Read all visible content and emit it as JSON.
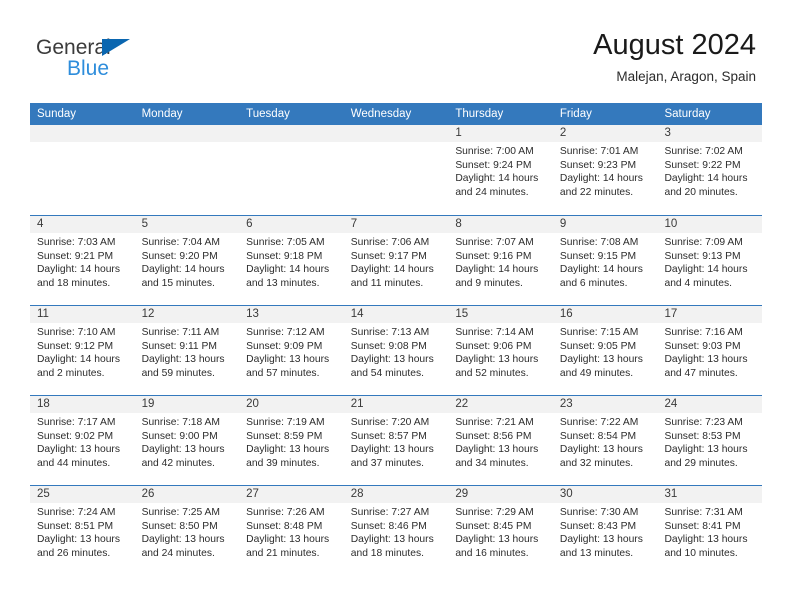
{
  "brand": {
    "name_part1": "General",
    "name_part2": "Blue",
    "triangle_icon": "triangle-icon",
    "accent_color": "#2e8ddb",
    "dark_color": "#3b3b3b",
    "triangle_color": "#0a66b0"
  },
  "header": {
    "title": "August 2024",
    "subtitle": "Malejan, Aragon, Spain"
  },
  "calendar": {
    "header_bg": "#3479bd",
    "daynum_bg": "#f2f2f2",
    "weekday_headers": [
      "Sunday",
      "Monday",
      "Tuesday",
      "Wednesday",
      "Thursday",
      "Friday",
      "Saturday"
    ],
    "labels": {
      "sunrise": "Sunrise:",
      "sunset": "Sunset:",
      "daylight": "Daylight:"
    },
    "weeks": [
      [
        {
          "day": ""
        },
        {
          "day": ""
        },
        {
          "day": ""
        },
        {
          "day": ""
        },
        {
          "day": "1",
          "sunrise": "Sunrise: 7:00 AM",
          "sunset": "Sunset: 9:24 PM",
          "daylight": "Daylight: 14 hours and 24 minutes."
        },
        {
          "day": "2",
          "sunrise": "Sunrise: 7:01 AM",
          "sunset": "Sunset: 9:23 PM",
          "daylight": "Daylight: 14 hours and 22 minutes."
        },
        {
          "day": "3",
          "sunrise": "Sunrise: 7:02 AM",
          "sunset": "Sunset: 9:22 PM",
          "daylight": "Daylight: 14 hours and 20 minutes."
        }
      ],
      [
        {
          "day": "4",
          "sunrise": "Sunrise: 7:03 AM",
          "sunset": "Sunset: 9:21 PM",
          "daylight": "Daylight: 14 hours and 18 minutes."
        },
        {
          "day": "5",
          "sunrise": "Sunrise: 7:04 AM",
          "sunset": "Sunset: 9:20 PM",
          "daylight": "Daylight: 14 hours and 15 minutes."
        },
        {
          "day": "6",
          "sunrise": "Sunrise: 7:05 AM",
          "sunset": "Sunset: 9:18 PM",
          "daylight": "Daylight: 14 hours and 13 minutes."
        },
        {
          "day": "7",
          "sunrise": "Sunrise: 7:06 AM",
          "sunset": "Sunset: 9:17 PM",
          "daylight": "Daylight: 14 hours and 11 minutes."
        },
        {
          "day": "8",
          "sunrise": "Sunrise: 7:07 AM",
          "sunset": "Sunset: 9:16 PM",
          "daylight": "Daylight: 14 hours and 9 minutes."
        },
        {
          "day": "9",
          "sunrise": "Sunrise: 7:08 AM",
          "sunset": "Sunset: 9:15 PM",
          "daylight": "Daylight: 14 hours and 6 minutes."
        },
        {
          "day": "10",
          "sunrise": "Sunrise: 7:09 AM",
          "sunset": "Sunset: 9:13 PM",
          "daylight": "Daylight: 14 hours and 4 minutes."
        }
      ],
      [
        {
          "day": "11",
          "sunrise": "Sunrise: 7:10 AM",
          "sunset": "Sunset: 9:12 PM",
          "daylight": "Daylight: 14 hours and 2 minutes."
        },
        {
          "day": "12",
          "sunrise": "Sunrise: 7:11 AM",
          "sunset": "Sunset: 9:11 PM",
          "daylight": "Daylight: 13 hours and 59 minutes."
        },
        {
          "day": "13",
          "sunrise": "Sunrise: 7:12 AM",
          "sunset": "Sunset: 9:09 PM",
          "daylight": "Daylight: 13 hours and 57 minutes."
        },
        {
          "day": "14",
          "sunrise": "Sunrise: 7:13 AM",
          "sunset": "Sunset: 9:08 PM",
          "daylight": "Daylight: 13 hours and 54 minutes."
        },
        {
          "day": "15",
          "sunrise": "Sunrise: 7:14 AM",
          "sunset": "Sunset: 9:06 PM",
          "daylight": "Daylight: 13 hours and 52 minutes."
        },
        {
          "day": "16",
          "sunrise": "Sunrise: 7:15 AM",
          "sunset": "Sunset: 9:05 PM",
          "daylight": "Daylight: 13 hours and 49 minutes."
        },
        {
          "day": "17",
          "sunrise": "Sunrise: 7:16 AM",
          "sunset": "Sunset: 9:03 PM",
          "daylight": "Daylight: 13 hours and 47 minutes."
        }
      ],
      [
        {
          "day": "18",
          "sunrise": "Sunrise: 7:17 AM",
          "sunset": "Sunset: 9:02 PM",
          "daylight": "Daylight: 13 hours and 44 minutes."
        },
        {
          "day": "19",
          "sunrise": "Sunrise: 7:18 AM",
          "sunset": "Sunset: 9:00 PM",
          "daylight": "Daylight: 13 hours and 42 minutes."
        },
        {
          "day": "20",
          "sunrise": "Sunrise: 7:19 AM",
          "sunset": "Sunset: 8:59 PM",
          "daylight": "Daylight: 13 hours and 39 minutes."
        },
        {
          "day": "21",
          "sunrise": "Sunrise: 7:20 AM",
          "sunset": "Sunset: 8:57 PM",
          "daylight": "Daylight: 13 hours and 37 minutes."
        },
        {
          "day": "22",
          "sunrise": "Sunrise: 7:21 AM",
          "sunset": "Sunset: 8:56 PM",
          "daylight": "Daylight: 13 hours and 34 minutes."
        },
        {
          "day": "23",
          "sunrise": "Sunrise: 7:22 AM",
          "sunset": "Sunset: 8:54 PM",
          "daylight": "Daylight: 13 hours and 32 minutes."
        },
        {
          "day": "24",
          "sunrise": "Sunrise: 7:23 AM",
          "sunset": "Sunset: 8:53 PM",
          "daylight": "Daylight: 13 hours and 29 minutes."
        }
      ],
      [
        {
          "day": "25",
          "sunrise": "Sunrise: 7:24 AM",
          "sunset": "Sunset: 8:51 PM",
          "daylight": "Daylight: 13 hours and 26 minutes."
        },
        {
          "day": "26",
          "sunrise": "Sunrise: 7:25 AM",
          "sunset": "Sunset: 8:50 PM",
          "daylight": "Daylight: 13 hours and 24 minutes."
        },
        {
          "day": "27",
          "sunrise": "Sunrise: 7:26 AM",
          "sunset": "Sunset: 8:48 PM",
          "daylight": "Daylight: 13 hours and 21 minutes."
        },
        {
          "day": "28",
          "sunrise": "Sunrise: 7:27 AM",
          "sunset": "Sunset: 8:46 PM",
          "daylight": "Daylight: 13 hours and 18 minutes."
        },
        {
          "day": "29",
          "sunrise": "Sunrise: 7:29 AM",
          "sunset": "Sunset: 8:45 PM",
          "daylight": "Daylight: 13 hours and 16 minutes."
        },
        {
          "day": "30",
          "sunrise": "Sunrise: 7:30 AM",
          "sunset": "Sunset: 8:43 PM",
          "daylight": "Daylight: 13 hours and 13 minutes."
        },
        {
          "day": "31",
          "sunrise": "Sunrise: 7:31 AM",
          "sunset": "Sunset: 8:41 PM",
          "daylight": "Daylight: 13 hours and 10 minutes."
        }
      ]
    ]
  }
}
